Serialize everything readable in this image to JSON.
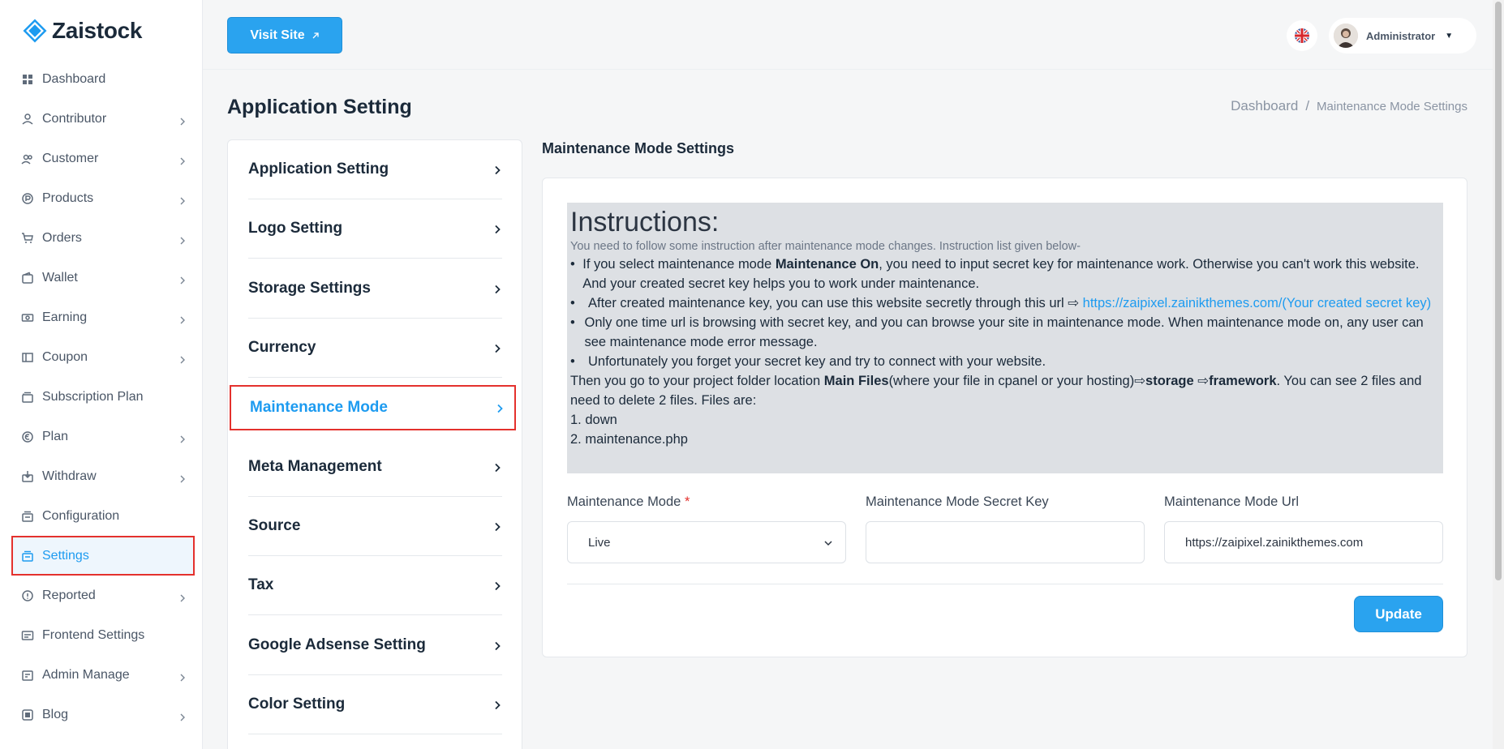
{
  "brand": {
    "name": "Zaistock",
    "accent": "#1d9bf0"
  },
  "sidebar": {
    "items": [
      {
        "label": "Dashboard",
        "icon": "grid-icon",
        "chevron": false
      },
      {
        "label": "Contributor",
        "icon": "contributor-icon",
        "chevron": true
      },
      {
        "label": "Customer",
        "icon": "users-icon",
        "chevron": true
      },
      {
        "label": "Products",
        "icon": "products-icon",
        "chevron": true
      },
      {
        "label": "Orders",
        "icon": "cart-icon",
        "chevron": true
      },
      {
        "label": "Wallet",
        "icon": "wallet-icon",
        "chevron": true
      },
      {
        "label": "Earning",
        "icon": "money-icon",
        "chevron": true
      },
      {
        "label": "Coupon",
        "icon": "coupon-icon",
        "chevron": true
      },
      {
        "label": "Subscription Plan",
        "icon": "subscription-icon",
        "chevron": false
      },
      {
        "label": "Plan",
        "icon": "plan-icon",
        "chevron": true
      },
      {
        "label": "Withdraw",
        "icon": "withdraw-icon",
        "chevron": true
      },
      {
        "label": "Configuration",
        "icon": "configuration-icon",
        "chevron": false
      },
      {
        "label": "Settings",
        "icon": "settings-icon",
        "chevron": false,
        "active": true
      },
      {
        "label": "Reported",
        "icon": "reported-icon",
        "chevron": true
      },
      {
        "label": "Frontend Settings",
        "icon": "frontend-icon",
        "chevron": false
      },
      {
        "label": "Admin Manage",
        "icon": "admin-icon",
        "chevron": true
      },
      {
        "label": "Blog",
        "icon": "blog-icon",
        "chevron": true
      }
    ]
  },
  "topbar": {
    "visit_site_label": "Visit Site",
    "user_name": "Administrator"
  },
  "page": {
    "title": "Application Setting",
    "breadcrumb": {
      "home": "Dashboard",
      "separator": "/",
      "current": "Maintenance Mode Settings"
    }
  },
  "settings_menu": [
    {
      "label": "Application Setting"
    },
    {
      "label": "Logo Setting"
    },
    {
      "label": "Storage Settings"
    },
    {
      "label": "Currency"
    },
    {
      "label": "Maintenance Mode",
      "active": true
    },
    {
      "label": "Meta Management"
    },
    {
      "label": "Source"
    },
    {
      "label": "Tax"
    },
    {
      "label": "Google Adsense Setting"
    },
    {
      "label": "Color Setting"
    }
  ],
  "maintenance": {
    "section_title": "Maintenance Mode Settings",
    "instructions": {
      "heading": "Instructions:",
      "intro": "You need to follow some instruction after maintenance mode changes. Instruction list given below-",
      "b1_pre": "If you select maintenance mode ",
      "b1_bold": "Maintenance On",
      "b1_post": ", you need to input secret key for maintenance work. Otherwise you can't work this website. And your created secret key helps you to work under maintenance.",
      "b2_pre": "After created maintenance key, you can use this website secretly through this url ⇨ ",
      "b2_link": "https://zaipixel.zainikthemes.com/(Your created secret key)",
      "b3": "Only one time url is browsing with secret key, and you can browse your site in maintenance mode. When maintenance mode on, any user can see maintenance mode error message.",
      "b4": "Unfortunately you forget your secret key and try to connect with your website.",
      "then_pre": "Then you go to your project folder location ",
      "then_bold1": "Main Files",
      "then_mid": "(where your file in cpanel or your hosting)⇨",
      "then_bold2": "storage",
      "then_arrow": " ⇨",
      "then_bold3": "framework",
      "then_post": ". You can see 2 files and need to delete 2 files. Files are:",
      "file1": "1. down",
      "file2": "2. maintenance.php"
    },
    "mode_label": "Maintenance Mode",
    "required_mark": "*",
    "mode_value": "Live",
    "secret_key_label": "Maintenance Mode Secret Key",
    "secret_key_value": "",
    "url_label": "Maintenance Mode Url",
    "url_value": "https://zaipixel.zainikthemes.com",
    "update_label": "Update"
  }
}
